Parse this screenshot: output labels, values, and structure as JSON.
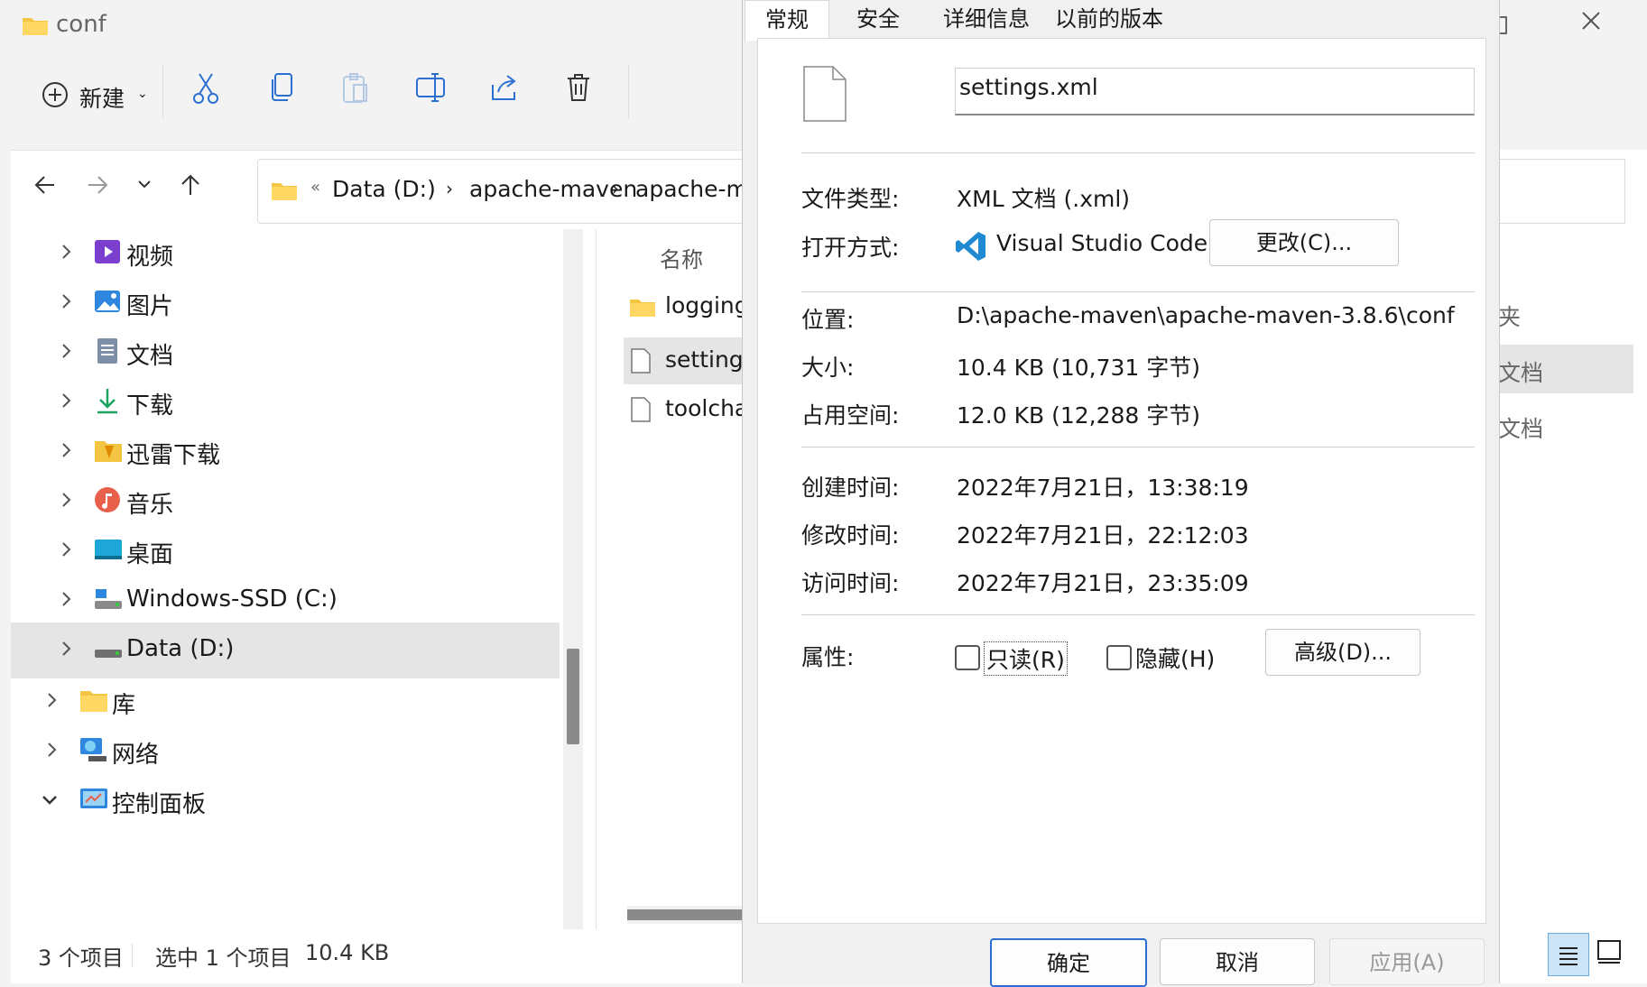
{
  "explorer": {
    "window_title": "conf",
    "toolbar": {
      "new_label": "新建"
    },
    "address": [
      "Data (D:)",
      "apache-maven",
      "apache-m"
    ],
    "tree": [
      {
        "label": "视频",
        "icon": "video-icon"
      },
      {
        "label": "图片",
        "icon": "pictures-icon"
      },
      {
        "label": "文档",
        "icon": "documents-icon"
      },
      {
        "label": "下载",
        "icon": "download-icon"
      },
      {
        "label": "迅雷下载",
        "icon": "xunlei-folder-icon"
      },
      {
        "label": "音乐",
        "icon": "music-icon"
      },
      {
        "label": "桌面",
        "icon": "desktop-icon"
      },
      {
        "label": "Windows-SSD (C:)",
        "icon": "drive-c-icon"
      },
      {
        "label": "Data (D:)",
        "icon": "drive-d-icon"
      },
      {
        "label": "库",
        "icon": "library-icon"
      },
      {
        "label": "网络",
        "icon": "network-icon"
      },
      {
        "label": "控制面板",
        "icon": "control-panel-icon"
      }
    ],
    "column_header": "名称",
    "files": [
      "logging",
      "settings",
      "toolcha"
    ],
    "status": {
      "count": "3 个项目",
      "selected": "选中 1 个项目",
      "size": "10.4 KB"
    }
  },
  "background_right": {
    "items": [
      "夹",
      "文档",
      "文档"
    ]
  },
  "dialog": {
    "tabs": [
      "常规",
      "安全",
      "详细信息",
      "以前的版本"
    ],
    "file_name": "settings.xml",
    "labels": {
      "type": "文件类型:",
      "open_with": "打开方式:",
      "location": "位置:",
      "size": "大小:",
      "size_on_disk": "占用空间:",
      "created": "创建时间:",
      "modified": "修改时间:",
      "accessed": "访问时间:",
      "attributes": "属性:"
    },
    "values": {
      "type": "XML 文档 (.xml)",
      "open_with": "Visual Studio Code",
      "location": "D:\\apache-maven\\apache-maven-3.8.6\\conf",
      "size": "10.4 KB (10,731 字节)",
      "size_on_disk": "12.0 KB (12,288 字节)",
      "created": "2022年7月21日，13:38:19",
      "modified": "2022年7月21日，22:12:03",
      "accessed": "2022年7月21日，23:35:09"
    },
    "buttons": {
      "change": "更改(C)...",
      "readonly": "只读(R)",
      "hidden": "隐藏(H)",
      "advanced": "高级(D)...",
      "ok": "确定",
      "cancel": "取消",
      "apply": "应用(A)"
    },
    "checkboxes": {
      "readonly": false,
      "hidden": false
    }
  }
}
